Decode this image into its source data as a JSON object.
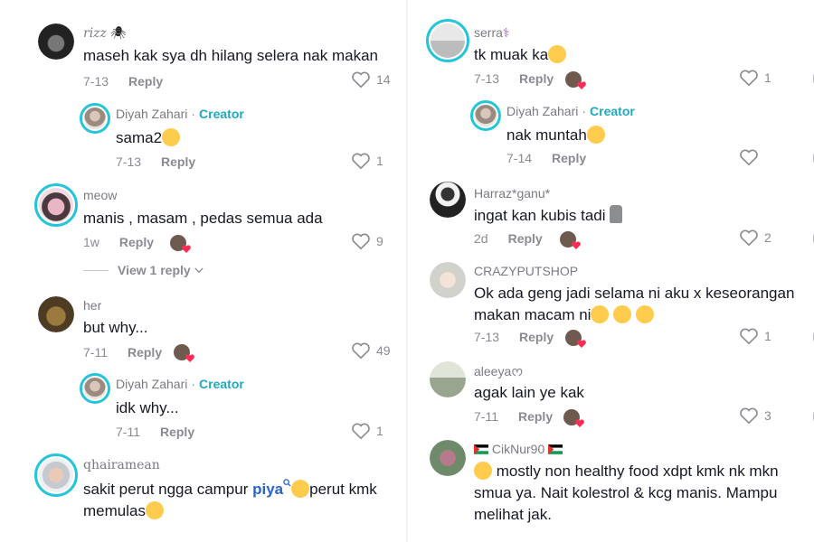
{
  "left": [
    {
      "user": "rizz",
      "deco": "🕷",
      "text": "maseh kak sya dh hilang selera nak makan",
      "date": "7-13",
      "reply": "Reply",
      "likes": "14"
    },
    {
      "user": "Diyah Zahari",
      "role": "Creator",
      "sep": "·",
      "text": "sama2",
      "date": "7-13",
      "reply": "Reply",
      "likes": "1"
    },
    {
      "user": "meow",
      "text": "manis , masam , pedas semua ada",
      "date": "1w",
      "reply": "Reply",
      "likes": "9",
      "view_replies": "View 1 reply"
    },
    {
      "user": "her",
      "text": "but why...",
      "date": "7-11",
      "reply": "Reply",
      "likes": "49"
    },
    {
      "user": "Diyah Zahari",
      "role": "Creator",
      "sep": "·",
      "text": "idk why...",
      "date": "7-11",
      "reply": "Reply",
      "likes": "1"
    },
    {
      "user": "qhairamean",
      "text_a": "sakit perut ngga campur ",
      "mention": "piya",
      "text_b": "perut kmk",
      "text_c": "memulas"
    }
  ],
  "right": [
    {
      "user": "serra",
      "text": "tk muak ka",
      "date": "7-13",
      "reply": "Reply",
      "likes": "1"
    },
    {
      "user": "Diyah Zahari",
      "role": "Creator",
      "sep": "·",
      "text": "nak muntah",
      "date": "7-14",
      "reply": "Reply",
      "likes": ""
    },
    {
      "user": "Harraz*ganu*",
      "text": "ingat kan kubis tadi",
      "date": "2d",
      "reply": "Reply",
      "likes": "2"
    },
    {
      "user": "CRAZYPUTSHOP",
      "text_a": "Ok ada geng jadi selama ni aku x keseorangan",
      "text_b": "makan macam ni",
      "date": "7-13",
      "reply": "Reply",
      "likes": "1"
    },
    {
      "user": "aleeya",
      "text": "agak lain ye kak",
      "date": "7-11",
      "reply": "Reply",
      "likes": "3"
    },
    {
      "user": "CikNur90",
      "text_a": " mostly non healthy food xdpt kmk nk mkn",
      "text_b": "smua ya. Nait kolestrol & kcg manis. Mampu",
      "text_c": "melihat jak."
    }
  ],
  "colors": {
    "creator": "#20a8c2",
    "ring": "#25c5d9",
    "mention": "#2b63c8",
    "liked_badge": "#fe2c55"
  }
}
